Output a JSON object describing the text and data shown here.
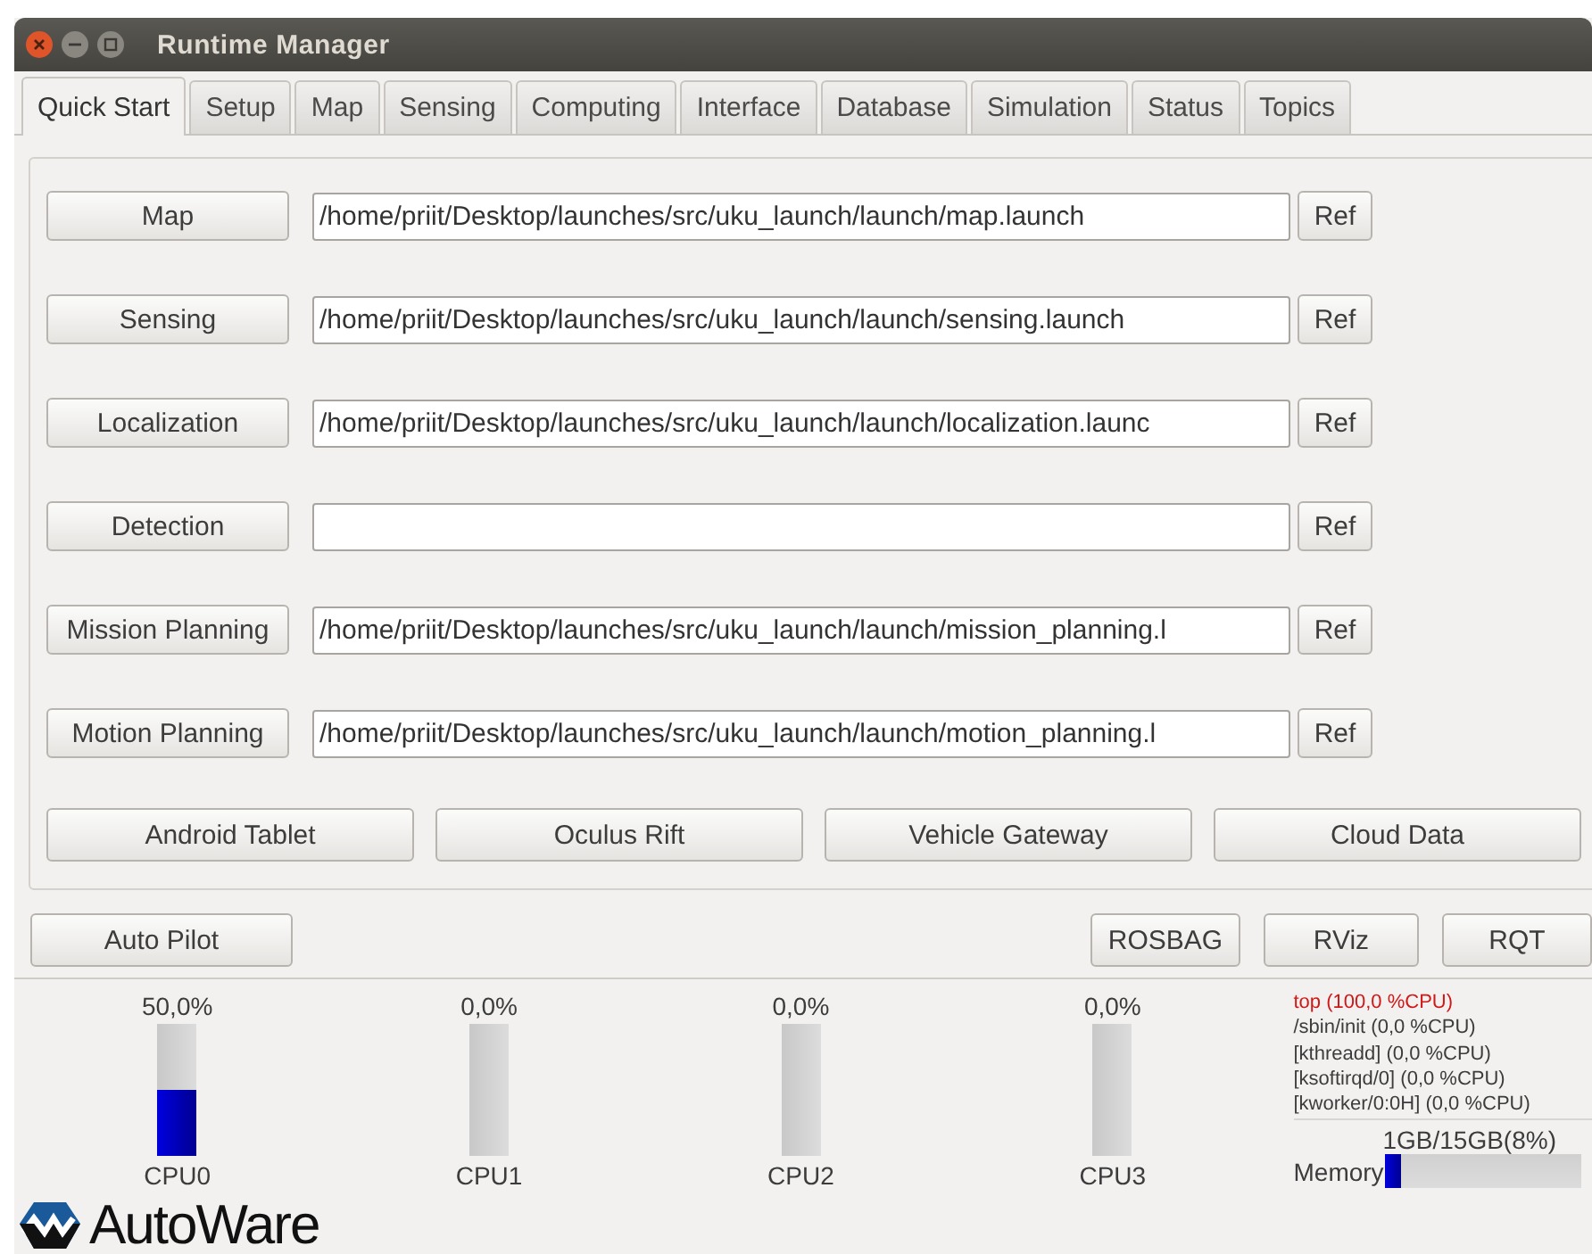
{
  "window": {
    "title": "Runtime Manager"
  },
  "tabs": [
    {
      "label": "Quick Start",
      "selected": true
    },
    {
      "label": "Setup",
      "selected": false
    },
    {
      "label": "Map",
      "selected": false
    },
    {
      "label": "Sensing",
      "selected": false
    },
    {
      "label": "Computing",
      "selected": false
    },
    {
      "label": "Interface",
      "selected": false
    },
    {
      "label": "Database",
      "selected": false
    },
    {
      "label": "Simulation",
      "selected": false
    },
    {
      "label": "Status",
      "selected": false
    },
    {
      "label": "Topics",
      "selected": false
    }
  ],
  "launch_rows": [
    {
      "button": "Map",
      "path": "/home/priit/Desktop/launches/src/uku_launch/launch/map.launch",
      "ref": "Ref"
    },
    {
      "button": "Sensing",
      "path": "/home/priit/Desktop/launches/src/uku_launch/launch/sensing.launch",
      "ref": "Ref"
    },
    {
      "button": "Localization",
      "path": "/home/priit/Desktop/launches/src/uku_launch/launch/localization.launc",
      "ref": "Ref"
    },
    {
      "button": "Detection",
      "path": "",
      "ref": "Ref"
    },
    {
      "button": "Mission Planning",
      "path": "/home/priit/Desktop/launches/src/uku_launch/launch/mission_planning.l",
      "ref": "Ref"
    },
    {
      "button": "Motion Planning",
      "path": "/home/priit/Desktop/launches/src/uku_launch/launch/motion_planning.l",
      "ref": "Ref"
    }
  ],
  "device_buttons": [
    "Android Tablet",
    "Oculus Rift",
    "Vehicle Gateway",
    "Cloud Data"
  ],
  "left_buttons": [
    "Auto Pilot"
  ],
  "right_buttons": [
    "ROSBAG",
    "RViz",
    "RQT"
  ],
  "cpus": [
    {
      "reading": "50,0%",
      "label": "CPU0",
      "level": 0.5
    },
    {
      "reading": "0,0%",
      "label": "CPU1",
      "level": 0
    },
    {
      "reading": "0,0%",
      "label": "CPU2",
      "level": 0
    },
    {
      "reading": "0,0%",
      "label": "CPU3",
      "level": 0
    }
  ],
  "processes": [
    {
      "text": "top (100,0 %CPU)",
      "highlighted": true
    },
    {
      "text": "/sbin/init (0,0 %CPU)",
      "highlighted": false
    },
    {
      "text": "[kthreadd] (0,0 %CPU)",
      "highlighted": false
    },
    {
      "text": "[ksoftirqd/0] (0,0 %CPU)",
      "highlighted": false
    },
    {
      "text": "[kworker/0:0H] (0,0 %CPU)",
      "highlighted": false
    }
  ],
  "memory": {
    "reading": "1GB/15GB(8%)",
    "label": "Memory",
    "level": 0.08
  },
  "logo": {
    "text": "AutoWare"
  }
}
